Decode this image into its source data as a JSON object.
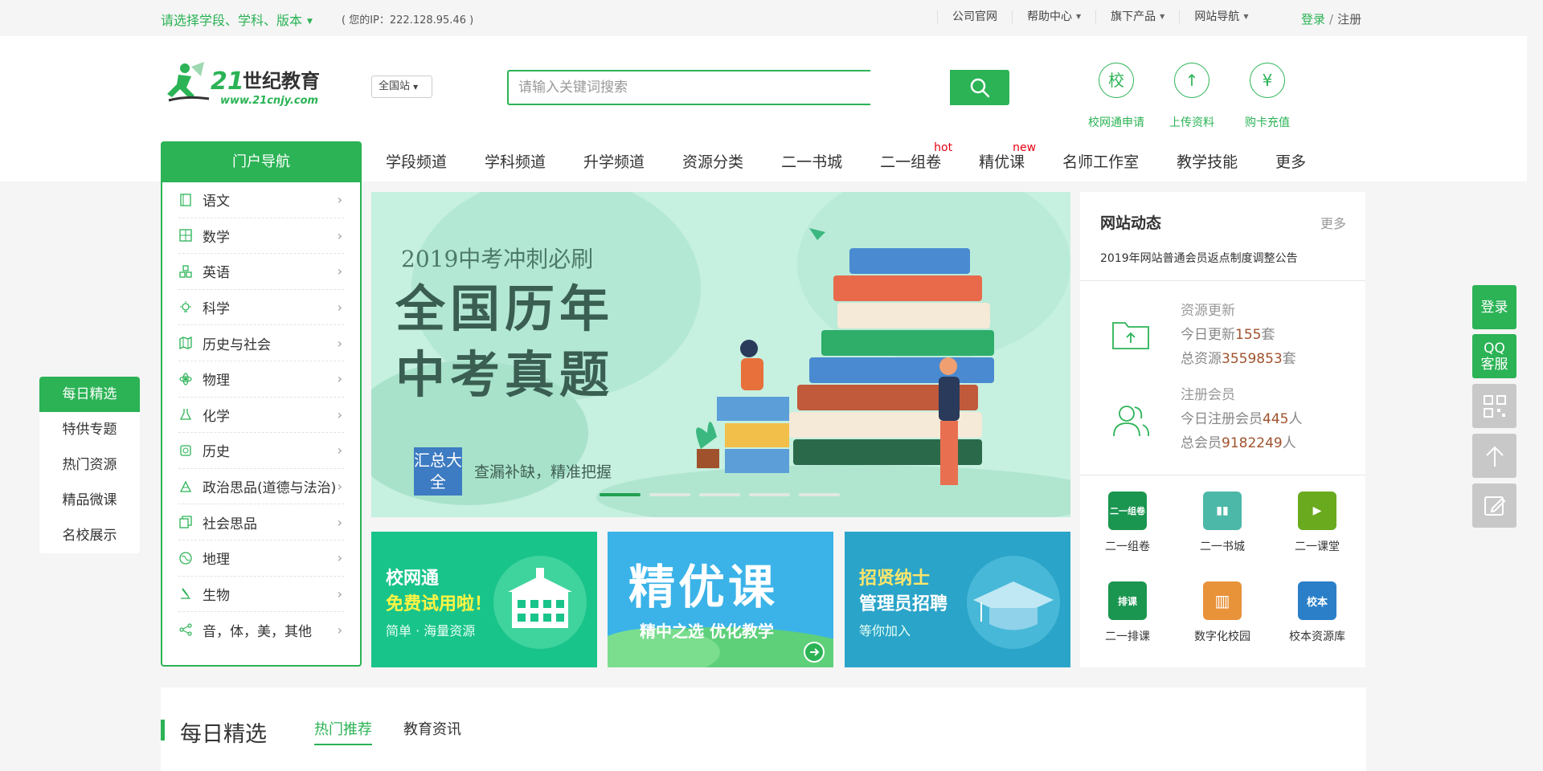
{
  "topbar": {
    "region_select": "请选择学段、学科、版本",
    "ip_text": "( 您的IP：222.128.95.46 )",
    "links": [
      {
        "label": "公司官网"
      },
      {
        "label": "帮助中心"
      },
      {
        "label": "旗下产品"
      },
      {
        "label": "网站导航"
      }
    ],
    "login": "登录",
    "sep": "/",
    "register": "注册"
  },
  "header": {
    "logo_text": "21世纪教育",
    "logo_url_text": "www.21cnjy.com",
    "station": "全国站",
    "search_placeholder": "请输入关键词搜索",
    "quick": [
      {
        "glyph": "校",
        "label": "校网通申请"
      },
      {
        "glyph": "↑",
        "label": "上传资料"
      },
      {
        "glyph": "¥",
        "label": "购卡充值"
      }
    ]
  },
  "nav": {
    "portal_title": "门户导航",
    "items": [
      {
        "label": "学段频道",
        "tag": ""
      },
      {
        "label": "学科频道",
        "tag": ""
      },
      {
        "label": "升学频道",
        "tag": ""
      },
      {
        "label": "资源分类",
        "tag": ""
      },
      {
        "label": "二一书城",
        "tag": ""
      },
      {
        "label": "二一组卷",
        "tag": "hot"
      },
      {
        "label": "精优课",
        "tag": "new"
      },
      {
        "label": "名师工作室",
        "tag": ""
      },
      {
        "label": "教学技能",
        "tag": ""
      },
      {
        "label": "更多",
        "tag": ""
      }
    ]
  },
  "categories": [
    {
      "label": "语文",
      "icon": "book-icon"
    },
    {
      "label": "数学",
      "icon": "calculator-icon"
    },
    {
      "label": "英语",
      "icon": "abc-blocks-icon"
    },
    {
      "label": "科学",
      "icon": "bulb-icon"
    },
    {
      "label": "历史与社会",
      "icon": "map-icon"
    },
    {
      "label": "物理",
      "icon": "atom-icon"
    },
    {
      "label": "化学",
      "icon": "flask-icon"
    },
    {
      "label": "历史",
      "icon": "scroll-icon"
    },
    {
      "label": "政治思品(道德与法治)",
      "icon": "flag-icon"
    },
    {
      "label": "社会思品",
      "icon": "cards-icon"
    },
    {
      "label": "地理",
      "icon": "globe-icon"
    },
    {
      "label": "生物",
      "icon": "microscope-icon"
    },
    {
      "label": "音，体，美，其他",
      "icon": "share-icon"
    }
  ],
  "leftnav": [
    "每日精选",
    "特供专题",
    "热门资源",
    "精品微课",
    "名校展示"
  ],
  "banner": {
    "line1": "2019中考冲刺必刷",
    "line2": "全国历年中考真题",
    "badge": "汇总大全",
    "line3": "查漏补缺，精准把握",
    "slides": 5,
    "active_slide": 1
  },
  "promos": [
    {
      "title": "校网通",
      "highlight": "免费试用啦！",
      "sub": "简单 · 海量资源"
    },
    {
      "title": "精优课",
      "sub": "精中之选  优化教学"
    },
    {
      "title": "招贤纳士",
      "highlight": "管理员招聘",
      "sub": "等你加入"
    }
  ],
  "side": {
    "title": "网站动态",
    "more": "更多",
    "news": "2019年网站普通会员返点制度调整公告",
    "resource": {
      "label": "资源更新",
      "today_prefix": "今日更新",
      "today_value": "155",
      "today_unit": "套",
      "total_prefix": "总资源",
      "total_value": "3559853",
      "total_unit": "套"
    },
    "members": {
      "label": "注册会员",
      "today_prefix": "今日注册会员",
      "today_value": "445",
      "today_unit": "人",
      "total_prefix": "总会员",
      "total_value": "9182249",
      "total_unit": "人"
    },
    "apps": [
      {
        "label": "二一组卷",
        "glyph": "二一组卷",
        "color": "#1a9650"
      },
      {
        "label": "二一书城",
        "glyph": "▮▮",
        "color": "#4cb8a8"
      },
      {
        "label": "二一课堂",
        "glyph": "▶",
        "color": "#6aaa1e"
      },
      {
        "label": "二一排课",
        "glyph": "排课",
        "color": "#1a9650"
      },
      {
        "label": "数字化校园",
        "glyph": "▥",
        "color": "#e8923a"
      },
      {
        "label": "校本资源库",
        "glyph": "校本",
        "color": "#2a7fc8"
      }
    ]
  },
  "floaters": [
    {
      "label": "登录",
      "color": "#2bb355"
    },
    {
      "label": "QQ客服",
      "color": "#2bb355"
    },
    {
      "label": "",
      "color": "#c8c8c8"
    },
    {
      "label": "",
      "color": "#c8c8c8"
    },
    {
      "label": "",
      "color": "#c8c8c8"
    }
  ],
  "daily": {
    "title": "每日精选",
    "tabs": [
      "热门推荐",
      "教育资讯"
    ]
  }
}
